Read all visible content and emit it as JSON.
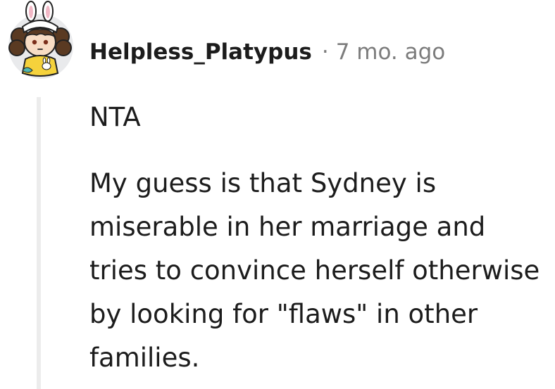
{
  "comment": {
    "author": "Helpless_Platypus",
    "separator": "·",
    "timestamp": "7 mo. ago",
    "avatar_icon": "snoo-avatar-bunny-hat",
    "paragraphs": {
      "p1": "NTA",
      "p2": "My guess is that Sydney is miserable in her marriage and tries to convince herself otherwise by looking for \"flaws\" in other families."
    }
  },
  "colors": {
    "text": "#1c1c1c",
    "meta_text": "#7c7c7c",
    "thread_line": "#ececec",
    "avatar_bg": "#e9eaec"
  }
}
